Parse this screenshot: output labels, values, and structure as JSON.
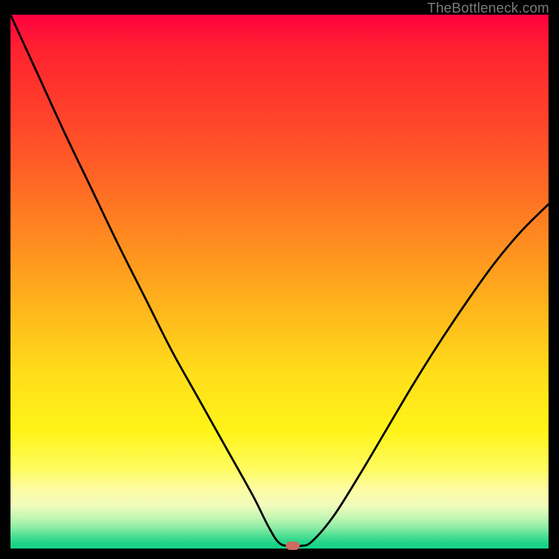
{
  "attribution": "TheBottleneck.com",
  "colors": {
    "marker": "#cc6a63",
    "curve": "#000000"
  },
  "chart_data": {
    "type": "line",
    "title": "",
    "xlabel": "",
    "ylabel": "",
    "xlim": [
      0,
      100
    ],
    "ylim": [
      0,
      100
    ],
    "grid": false,
    "series": [
      {
        "name": "bottleneck-curve",
        "x": [
          0,
          5,
          10,
          15,
          20,
          25,
          30,
          35,
          40,
          45,
          48,
          50,
          52,
          54,
          56,
          60,
          65,
          70,
          75,
          80,
          85,
          90,
          95,
          100
        ],
        "y": [
          100,
          89,
          78,
          67.5,
          57,
          47,
          37,
          28,
          19,
          10,
          4,
          1,
          0.5,
          0.5,
          1.3,
          6,
          14,
          22.5,
          31,
          39,
          46.5,
          53.5,
          59.5,
          64.5
        ]
      }
    ],
    "marker": {
      "x": 52.5,
      "y": 0.5
    },
    "gradient_stops": [
      {
        "pct": 0,
        "color": "#ff0040"
      },
      {
        "pct": 25,
        "color": "#ff5328"
      },
      {
        "pct": 47,
        "color": "#ff9b1e"
      },
      {
        "pct": 67,
        "color": "#ffdd1a"
      },
      {
        "pct": 85,
        "color": "#fffb5e"
      },
      {
        "pct": 94,
        "color": "#c7f7b4"
      },
      {
        "pct": 100,
        "color": "#14d186"
      }
    ]
  }
}
